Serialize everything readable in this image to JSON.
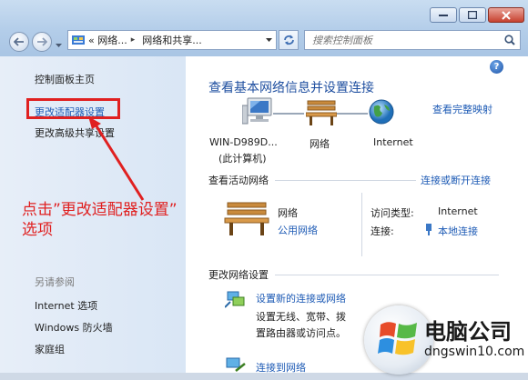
{
  "address_bar": {
    "crumbs": [
      "« 网络...",
      "网络和共享..."
    ],
    "search_placeholder": "搜索控制面板"
  },
  "sidebar": {
    "home": "控制面板主页",
    "adapter_settings": "更改适配器设置",
    "advanced_sharing": "更改高级共享设置",
    "see_also_title": "另请参阅",
    "see_also": [
      "Internet 选项",
      "Windows 防火墙",
      "家庭组"
    ]
  },
  "main": {
    "title": "查看基本网络信息并设置连接",
    "full_map_link": "查看完整映射",
    "nodes": {
      "computer_name": "WIN-D989D...",
      "computer_sub": "(此计算机)",
      "network": "网络",
      "internet": "Internet"
    },
    "active_section_title": "查看活动网络",
    "connect_link": "连接或断开连接",
    "network_name": "网络",
    "network_type": "公用网络",
    "access_type_label": "访问类型:",
    "access_type_value": "Internet",
    "connections_label": "连接:",
    "connections_value": "本地连接",
    "change_section_title": "更改网络设置",
    "task1_link": "设置新的连接或网络",
    "task1_desc1": "设置无线、宽带、拨",
    "task1_desc2": "置路由器或访问点。",
    "task2_link": "连接到网络"
  },
  "annotation": {
    "line1": "点击”更改适配器设置”",
    "line2": "选项",
    "color": "#e02020"
  },
  "watermark": {
    "title": "电脑公司",
    "url": "dngswin10.com"
  },
  "colors": {
    "link": "#1e5bb5",
    "title_blue": "#1f4fa0",
    "sidebar_bg": "#dde8f5"
  }
}
